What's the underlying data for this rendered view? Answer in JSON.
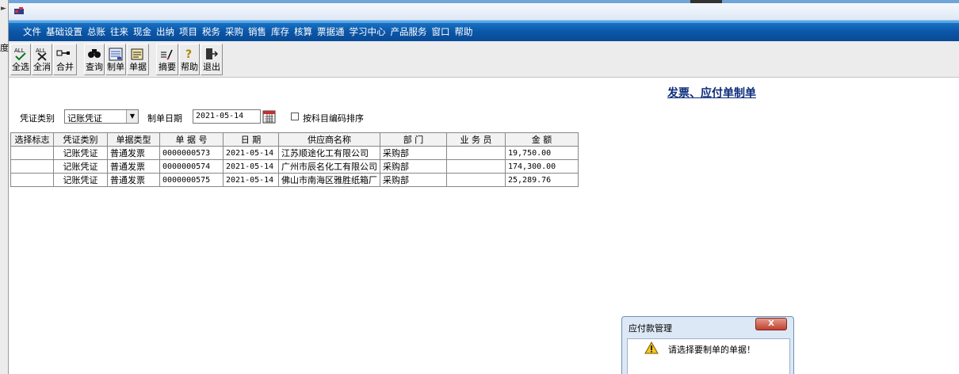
{
  "left_strip": {
    "cut_text": "度"
  },
  "menu": [
    "文件",
    "基础设置",
    "总账",
    "往来",
    "现金",
    "出纳",
    "项目",
    "税务",
    "采购",
    "销售",
    "库存",
    "核算",
    "票据通",
    "学习中心",
    "产品服务",
    "窗口",
    "帮助"
  ],
  "toolbar": {
    "select_all": "全选",
    "deselect_all": "全消",
    "merge": "合并",
    "query": "查询",
    "create": "制单",
    "voucher": "单据",
    "summary": "摘要",
    "help": "帮助",
    "exit": "退出"
  },
  "form": {
    "title": "发票、应付单制单",
    "voucher_type_label": "凭证类别",
    "voucher_type_value": "记账凭证",
    "date_label": "制单日期",
    "date_value": "2021-05-14",
    "sort_label": "按科目编码排序"
  },
  "table": {
    "headers": [
      "选择标志",
      "凭证类别",
      "单据类型",
      "单 据 号",
      "日    期",
      "供应商名称",
      "部    门",
      "业 务 员",
      "金    额"
    ],
    "rows": [
      [
        "",
        "记账凭证",
        "普通发票",
        "0000000573",
        "2021-05-14",
        "江苏顺途化工有限公司",
        "采购部",
        "",
        "19,750.00"
      ],
      [
        "",
        "记账凭证",
        "普通发票",
        "0000000574",
        "2021-05-14",
        "广州市辰名化工有限公司",
        "采购部",
        "",
        "174,300.00"
      ],
      [
        "",
        "记账凭证",
        "普通发票",
        "0000000575",
        "2021-05-14",
        "佛山市南海区雅胜纸箱厂",
        "采购部",
        "",
        "25,289.76"
      ]
    ]
  },
  "dialog": {
    "title": "应付款管理",
    "close_label": "X",
    "message": "请选择要制单的单据！"
  }
}
